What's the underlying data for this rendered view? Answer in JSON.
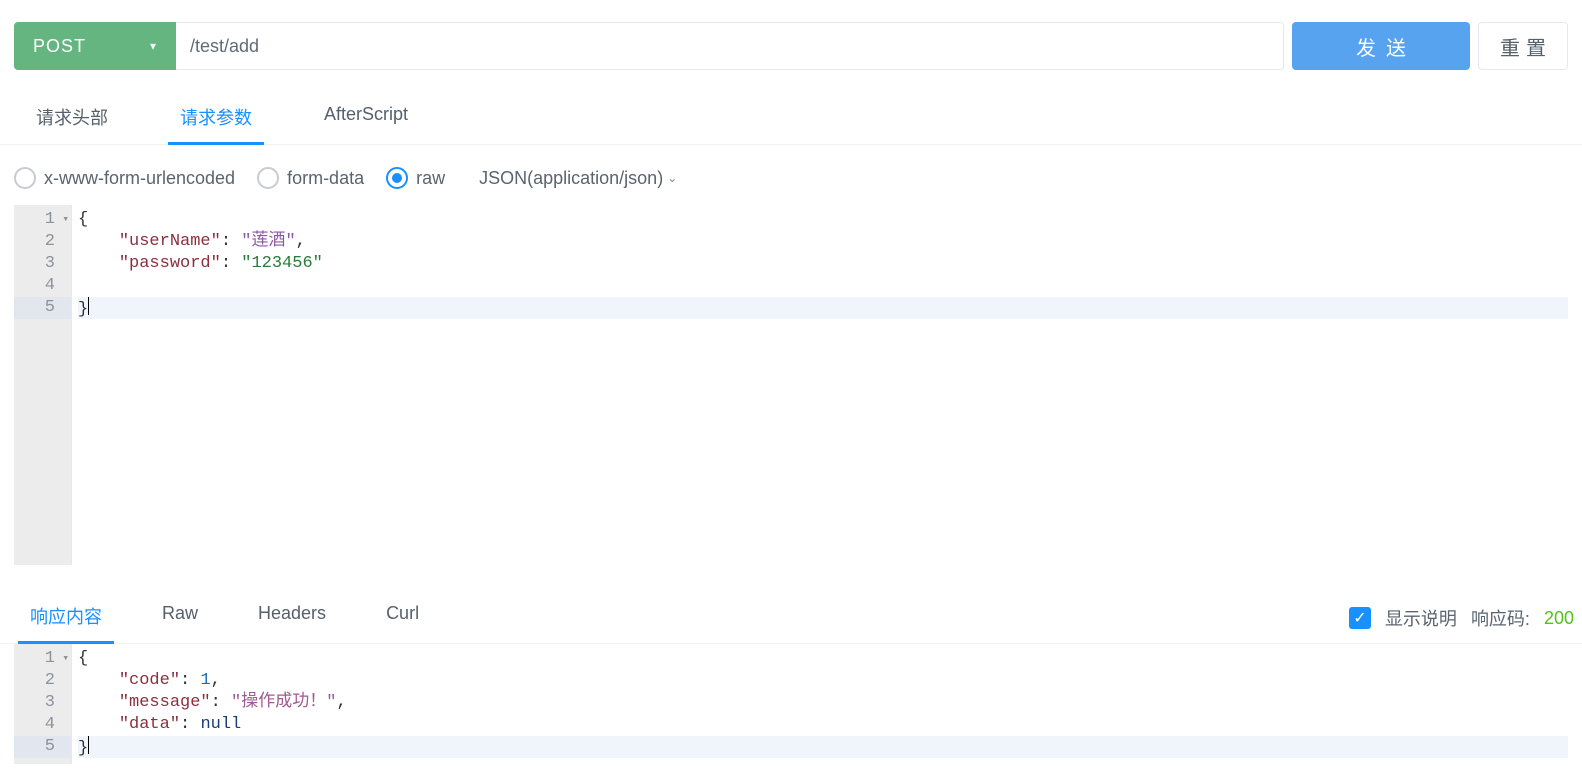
{
  "request": {
    "method": "POST",
    "url": "/test/add",
    "send_label": "发送",
    "reset_label": "重置"
  },
  "tabs": {
    "headers": "请求头部",
    "params": "请求参数",
    "afterscript": "AfterScript"
  },
  "body_type": {
    "xwww": "x-www-form-urlencoded",
    "formdata": "form-data",
    "raw": "raw",
    "content_type": "JSON(application/json)"
  },
  "request_body": {
    "lines": [
      {
        "n": "1",
        "fold": true,
        "tokens": [
          {
            "t": "{",
            "c": "p"
          }
        ]
      },
      {
        "n": "2",
        "tokens": [
          {
            "t": "    ",
            "c": ""
          },
          {
            "t": "\"userName\"",
            "c": "k"
          },
          {
            "t": ": ",
            "c": "p"
          },
          {
            "t": "\"莲酒\"",
            "c": "sz"
          },
          {
            "t": ",",
            "c": "p"
          }
        ]
      },
      {
        "n": "3",
        "tokens": [
          {
            "t": "    ",
            "c": ""
          },
          {
            "t": "\"password\"",
            "c": "k"
          },
          {
            "t": ": ",
            "c": "p"
          },
          {
            "t": "\"123456\"",
            "c": "s"
          }
        ]
      },
      {
        "n": "4",
        "tokens": [
          {
            "t": "    ",
            "c": ""
          }
        ]
      },
      {
        "n": "5",
        "hl": true,
        "cursor": true,
        "tokens": [
          {
            "t": "}",
            "c": "p"
          }
        ]
      }
    ]
  },
  "response_tabs": {
    "content": "响应内容",
    "raw": "Raw",
    "headers": "Headers",
    "curl": "Curl"
  },
  "response_meta": {
    "show_desc": "显示说明",
    "code_label": "响应码:",
    "code_value": "200"
  },
  "response_body": {
    "lines": [
      {
        "n": "1",
        "fold": true,
        "tokens": [
          {
            "t": "{",
            "c": "p"
          }
        ]
      },
      {
        "n": "2",
        "tokens": [
          {
            "t": "    ",
            "c": ""
          },
          {
            "t": "\"code\"",
            "c": "k"
          },
          {
            "t": ": ",
            "c": "p"
          },
          {
            "t": "1",
            "c": "n"
          },
          {
            "t": ",",
            "c": "p"
          }
        ]
      },
      {
        "n": "3",
        "tokens": [
          {
            "t": "    ",
            "c": ""
          },
          {
            "t": "\"message\"",
            "c": "k"
          },
          {
            "t": ": ",
            "c": "p"
          },
          {
            "t": "\"操作成功！\"",
            "c": "sz2"
          },
          {
            "t": ",",
            "c": "p"
          }
        ]
      },
      {
        "n": "4",
        "tokens": [
          {
            "t": "    ",
            "c": ""
          },
          {
            "t": "\"data\"",
            "c": "k"
          },
          {
            "t": ": ",
            "c": "p"
          },
          {
            "t": "null",
            "c": "u"
          }
        ]
      },
      {
        "n": "5",
        "hl": true,
        "cursor": true,
        "tokens": [
          {
            "t": "}",
            "c": "p"
          }
        ]
      }
    ]
  }
}
